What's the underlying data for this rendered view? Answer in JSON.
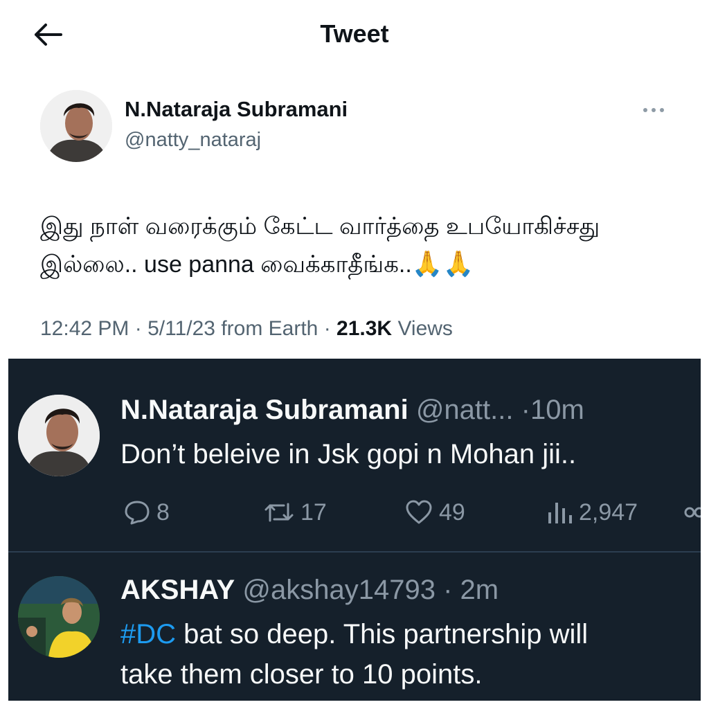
{
  "header": {
    "title": "Tweet",
    "back_icon": "arrow-left-icon"
  },
  "tweet": {
    "author_name": "N.Nataraja Subramani",
    "author_handle": "@natty_nataraj",
    "text_line1": "இது நாள் வரைக்கும் கேட்ட வார்த்தை உபயோகிச்சது",
    "text_line2": "இல்லை.. use panna வைக்காதீங்க..",
    "emoji": "🙏🙏",
    "time": "12:42 PM",
    "date": "5/11/23",
    "source": "from Earth",
    "views_count": "21.3K",
    "views_label": "Views"
  },
  "embedded": {
    "reply1": {
      "name": "N.Nataraja Subramani",
      "handle": "@natt...",
      "time": "·10m",
      "text": "Don’t beleive in Jsk gopi n Mohan jii..",
      "replies": "8",
      "retweets": "17",
      "likes": "49",
      "views": "2,947"
    },
    "reply2": {
      "name": "AKSHAY",
      "handle": "@akshay14793",
      "time": "· 2m",
      "hashtag": "#DC",
      "text_line1_rest": " bat so deep. This partnership will",
      "text_line2": "take them closer to 10 points."
    }
  },
  "colors": {
    "dark_bg": "#15202b",
    "accent": "#1d9bf0",
    "muted": "#536471"
  }
}
